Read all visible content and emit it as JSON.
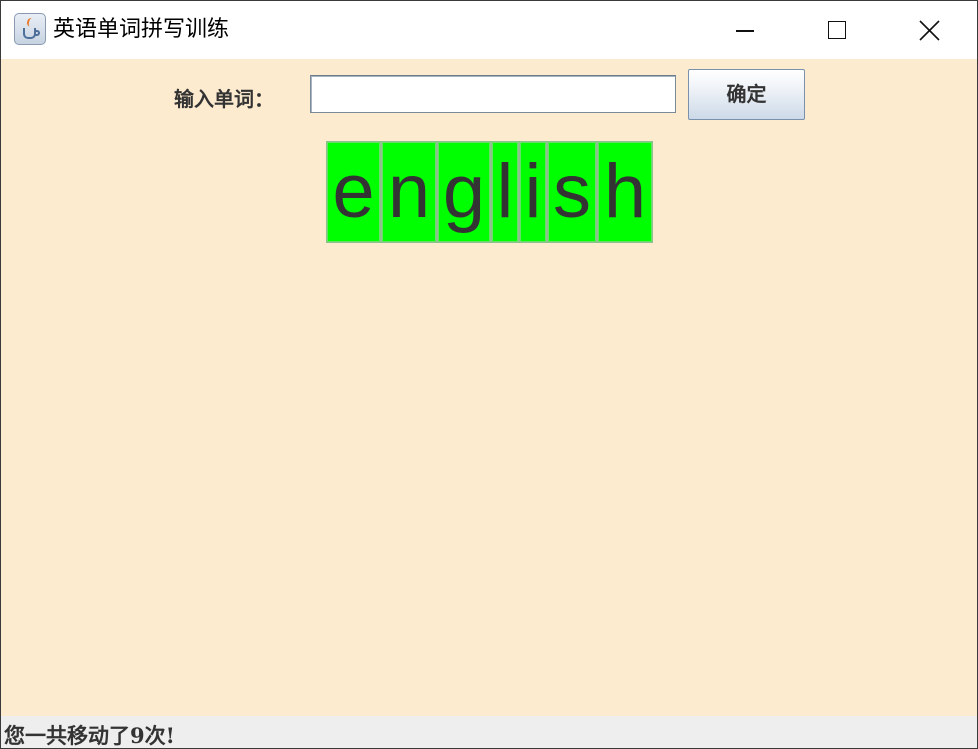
{
  "window": {
    "title": "英语单词拼写训练",
    "icon": "java-cup-icon",
    "controls": [
      "minimize-icon",
      "maximize-icon",
      "close-icon"
    ]
  },
  "form": {
    "input_label": "输入单词：",
    "input_value": "",
    "input_placeholder": "",
    "confirm_label": "确定"
  },
  "letters": [
    "e",
    "n",
    "g",
    "l",
    "i",
    "s",
    "h"
  ],
  "status": {
    "text": "您一共移动了9次!"
  },
  "colors": {
    "background": "#fdebd0",
    "tile": "#00ff00",
    "status_bar": "#eeeeee"
  }
}
